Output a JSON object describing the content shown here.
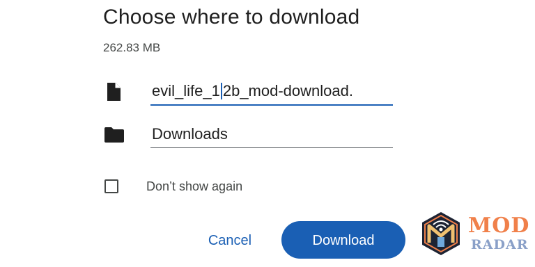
{
  "dialog": {
    "title": "Choose where to download",
    "file_size": "262.83 MB",
    "filename_field": {
      "value_before_caret": "evil_life_1",
      "value_after_caret": "2b_mod-download."
    },
    "location_field": {
      "value": "Downloads"
    },
    "dont_show_again": {
      "label": "Don’t show again",
      "checked": false
    },
    "buttons": {
      "cancel_label": "Cancel",
      "download_label": "Download"
    }
  },
  "icons": {
    "file": "file-icon",
    "folder": "folder-icon",
    "watermark_logo": "mod-radar-logo"
  },
  "watermark": {
    "line1": "MOD",
    "line2": "RADAR"
  },
  "colors": {
    "accent": "#1a5fb4",
    "watermark_orange": "#f0804a",
    "watermark_blue": "#8aa0c8"
  }
}
